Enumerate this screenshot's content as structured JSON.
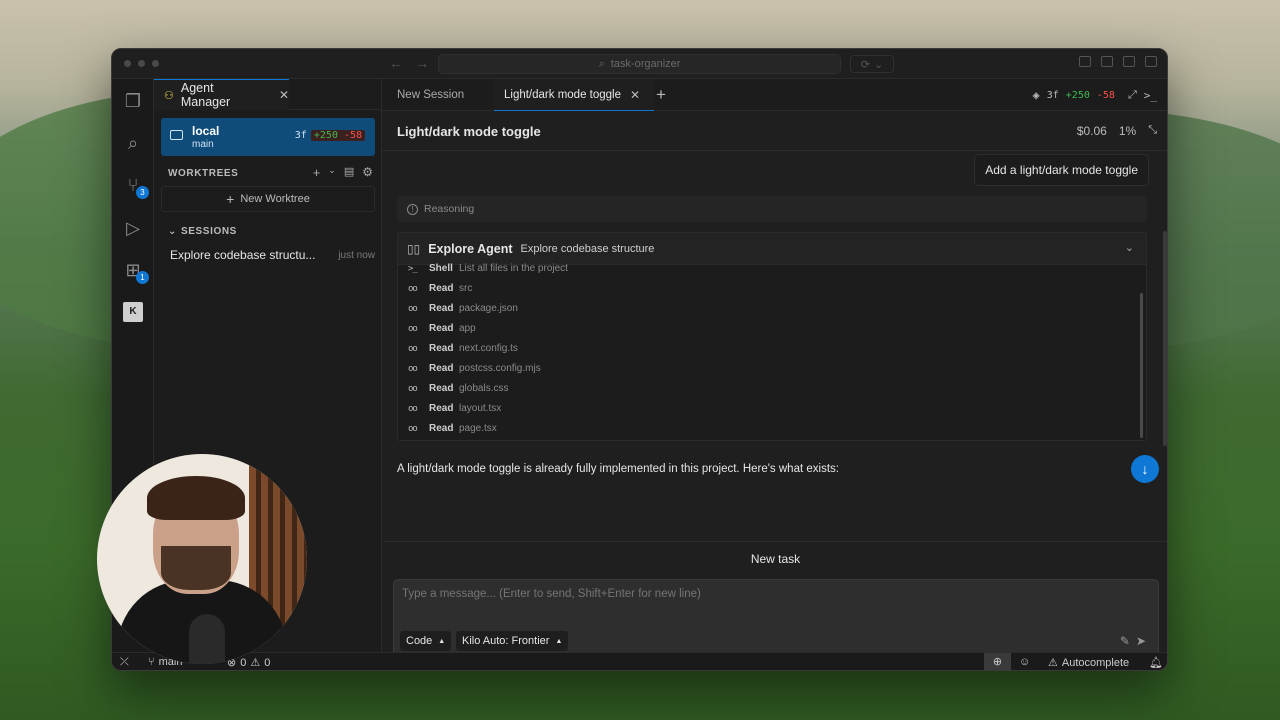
{
  "window": {
    "search_text": "task-organizer"
  },
  "activity_bar": {
    "source_control_badge": "3",
    "extensions_badge": "1"
  },
  "left_panel": {
    "tab_label": "Agent Manager",
    "local": {
      "name": "local",
      "branch": "main",
      "files": "3f",
      "added": "+250",
      "removed": "-58"
    },
    "worktrees_heading": "WORKTREES",
    "new_worktree_label": "New Worktree",
    "sessions_heading": "SESSIONS",
    "sessions": [
      {
        "title": "Explore codebase structu...",
        "time": "just now"
      }
    ]
  },
  "main": {
    "tabs": [
      {
        "label": "New Session"
      },
      {
        "label": "Light/dark mode toggle"
      }
    ],
    "stats": {
      "files": "3f",
      "added": "+250",
      "removed": "-58"
    },
    "session_title": "Light/dark mode toggle",
    "cost": "$0.06",
    "context_pct": "1%",
    "user_message": "Add a light/dark mode toggle",
    "reasoning_label": "Reasoning",
    "agent": {
      "name": "Explore Agent",
      "description": "Explore codebase structure",
      "tools": [
        {
          "kind": "Shell",
          "target": "List all files in the project",
          "icon": "terminal-icon"
        },
        {
          "kind": "Read",
          "target": "src",
          "icon": "glasses-icon"
        },
        {
          "kind": "Read",
          "target": "package.json",
          "icon": "glasses-icon"
        },
        {
          "kind": "Read",
          "target": "app",
          "icon": "glasses-icon"
        },
        {
          "kind": "Read",
          "target": "next.config.ts",
          "icon": "glasses-icon"
        },
        {
          "kind": "Read",
          "target": "postcss.config.mjs",
          "icon": "glasses-icon"
        },
        {
          "kind": "Read",
          "target": "globals.css",
          "icon": "glasses-icon"
        },
        {
          "kind": "Read",
          "target": "layout.tsx",
          "icon": "glasses-icon"
        },
        {
          "kind": "Read",
          "target": "page.tsx",
          "icon": "glasses-icon"
        }
      ]
    },
    "assistant_message": "A light/dark mode toggle is already fully implemented in this project. Here's what exists:",
    "new_task_label": "New task",
    "composer": {
      "placeholder": "Type a message... (Enter to send, Shift+Enter for new line)",
      "mode": "Code",
      "model": "Kilo Auto: Frontier"
    }
  },
  "status_bar": {
    "branch": "main",
    "errors": "0",
    "warnings": "0",
    "autocomplete": "Autocomplete"
  },
  "colors": {
    "accent": "#0e78d4",
    "added": "#3fb950",
    "removed": "#f85149"
  }
}
